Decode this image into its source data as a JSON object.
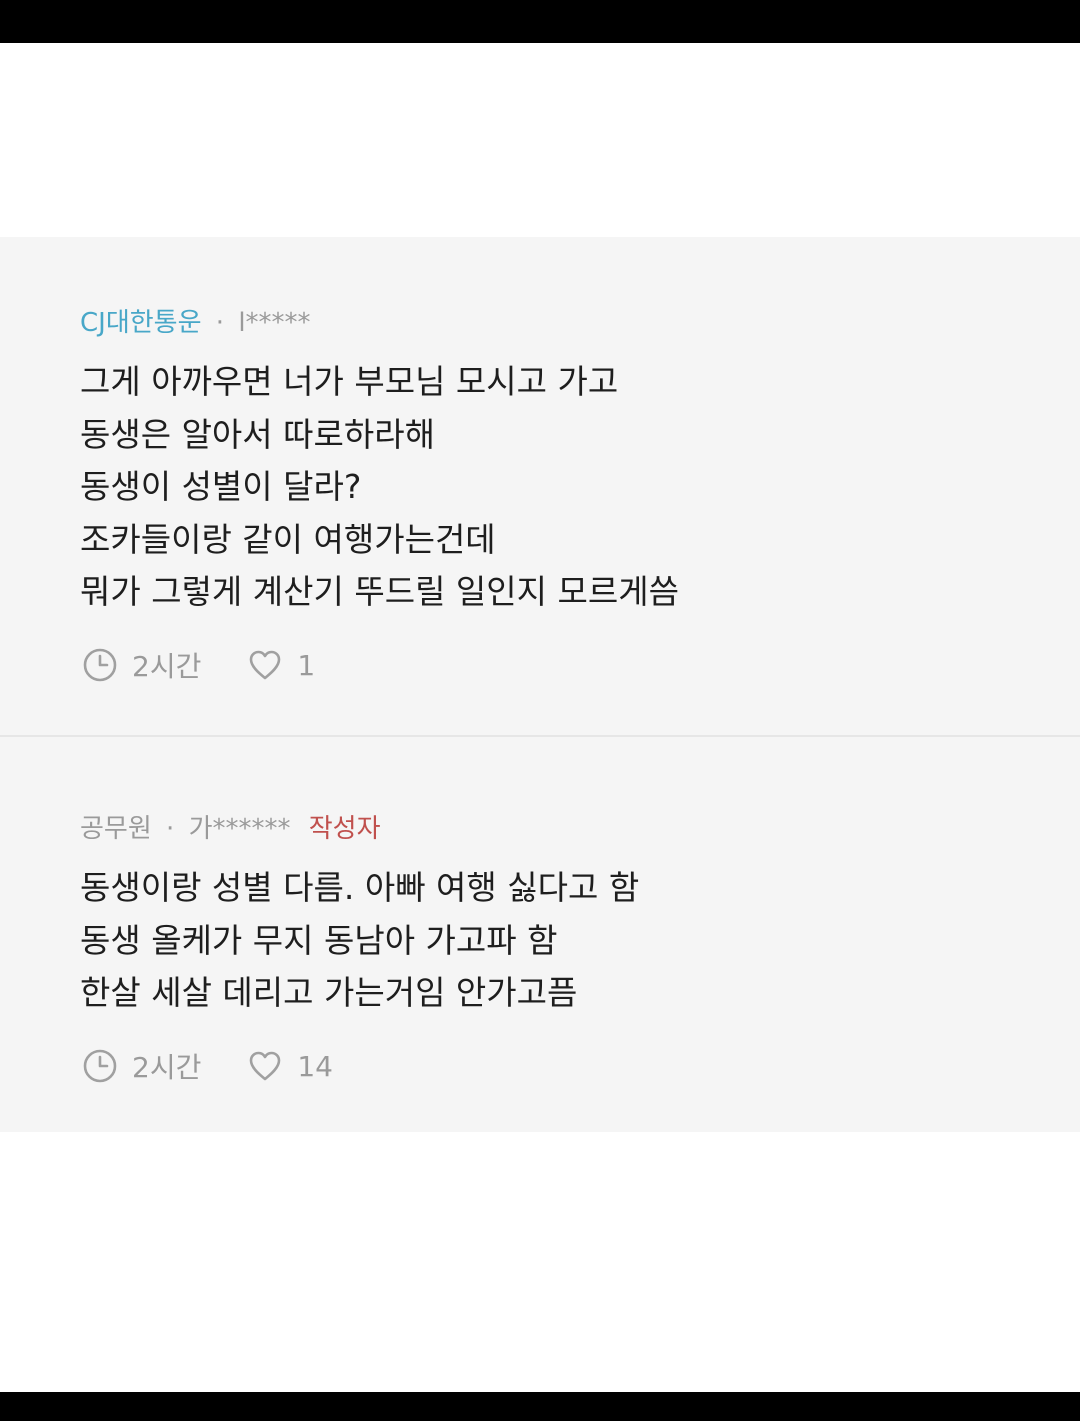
{
  "comments": [
    {
      "company": "CJ대한통운",
      "separator": "·",
      "username": "l*****",
      "author_badge": "",
      "lines": [
        "그게 아까우면 너가 부모님 모시고 가고",
        "동생은 알아서 따로하라해",
        "동생이 성별이 달라?",
        "조카들이랑 같이 여행가는건데",
        "뭐가 그렇게 계산기 뚜드릴 일인지 모르게씀"
      ],
      "time": "2시간",
      "likes": "1"
    },
    {
      "company": "공무원",
      "separator": "·",
      "username": "가******",
      "author_badge": "작성자",
      "lines": [
        "동생이랑 성별 다름. 아빠 여행 싫다고 함",
        "동생 올케가 무지 동남아 가고파 함",
        "한살 세살 데리고 가는거임 안가고픔"
      ],
      "time": "2시간",
      "likes": "14"
    }
  ],
  "icons": {
    "time": "clock-icon",
    "like": "heart-icon"
  },
  "colors": {
    "company_accent": "#48a7c8",
    "meta_gray": "#9a9a9a",
    "author_badge": "#c0504d",
    "body_text": "#1e1e1e",
    "card_background": "#f5f5f5"
  }
}
